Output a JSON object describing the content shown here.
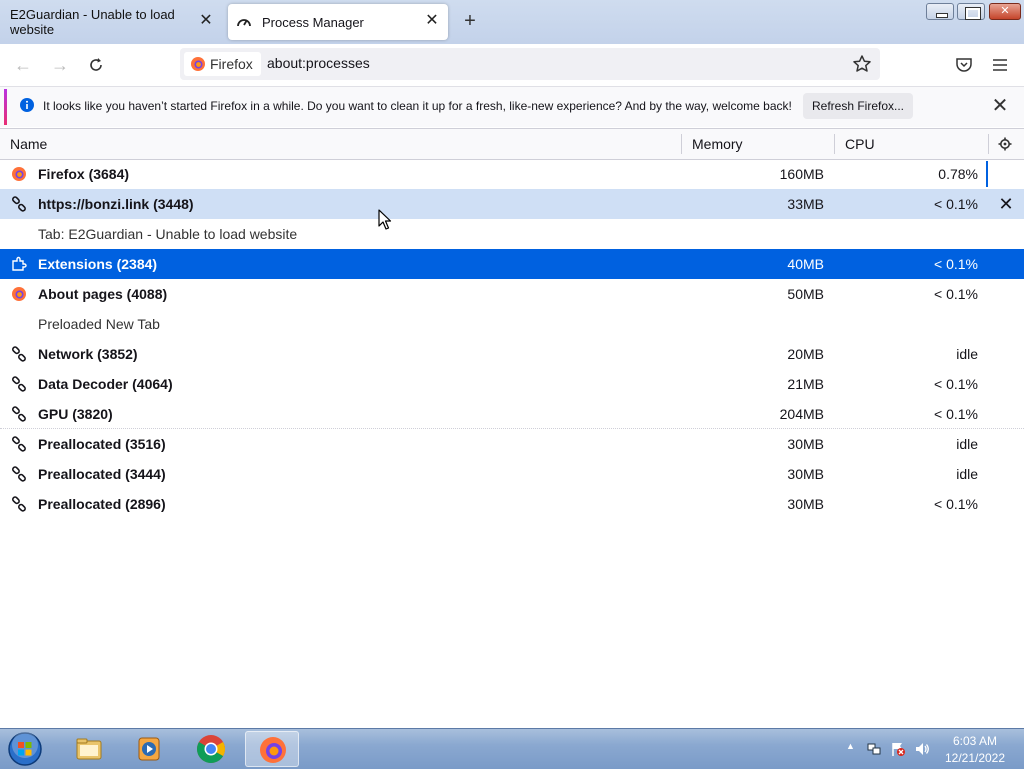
{
  "window": {
    "tabs": [
      {
        "title": "E2Guardian - Unable to load website",
        "active": false
      },
      {
        "title": "Process Manager",
        "active": true
      }
    ]
  },
  "navbar": {
    "identity_label": "Firefox",
    "url": "about:processes"
  },
  "notification": {
    "message": "It looks like you haven’t started Firefox in a while. Do you want to clean it up for a fresh, like-new experience? And by the way, welcome back!",
    "button_label": "Refresh Firefox..."
  },
  "table": {
    "columns": {
      "name": "Name",
      "memory": "Memory",
      "cpu": "CPU"
    },
    "rows": [
      {
        "icon": "firefox-icon",
        "name": "Firefox (3684)",
        "memory": "160MB",
        "cpu": "0.78%",
        "state": "normal"
      },
      {
        "icon": "link-icon",
        "name": "https://bonzi.link (3448)",
        "memory": "33MB",
        "cpu": "< 0.1%",
        "state": "hover"
      },
      {
        "icon": "",
        "name": "Tab: E2Guardian - Unable to load website",
        "memory": "",
        "cpu": "",
        "state": "sub"
      },
      {
        "icon": "puzzle-icon",
        "name": "Extensions (2384)",
        "memory": "40MB",
        "cpu": "< 0.1%",
        "state": "selected"
      },
      {
        "icon": "firefox-icon",
        "name": "About pages (4088)",
        "memory": "50MB",
        "cpu": "< 0.1%",
        "state": "normal"
      },
      {
        "icon": "",
        "name": "Preloaded New Tab",
        "memory": "",
        "cpu": "",
        "state": "sub"
      },
      {
        "icon": "link-icon",
        "name": "Network (3852)",
        "memory": "20MB",
        "cpu": "idle",
        "state": "normal"
      },
      {
        "icon": "link-icon",
        "name": "Data Decoder (4064)",
        "memory": "21MB",
        "cpu": "< 0.1%",
        "state": "normal"
      },
      {
        "icon": "link-icon",
        "name": "GPU (3820)",
        "memory": "204MB",
        "cpu": "< 0.1%",
        "state": "sep"
      },
      {
        "icon": "link-icon",
        "name": "Preallocated (3516)",
        "memory": "30MB",
        "cpu": "idle",
        "state": "normal"
      },
      {
        "icon": "link-icon",
        "name": "Preallocated (3444)",
        "memory": "30MB",
        "cpu": "idle",
        "state": "normal"
      },
      {
        "icon": "link-icon",
        "name": "Preallocated (2896)",
        "memory": "30MB",
        "cpu": "< 0.1%",
        "state": "normal"
      }
    ]
  },
  "taskbar": {
    "items": [
      "windows-explorer",
      "windows-media-player",
      "google-chrome",
      "firefox"
    ],
    "active_item": "firefox",
    "clock": {
      "time": "6:03 AM",
      "date": "12/21/2022"
    }
  },
  "colors": {
    "selected_row": "#0061e0",
    "hover_row": "#cfdff5",
    "taskbar": "#8aa8d0"
  }
}
